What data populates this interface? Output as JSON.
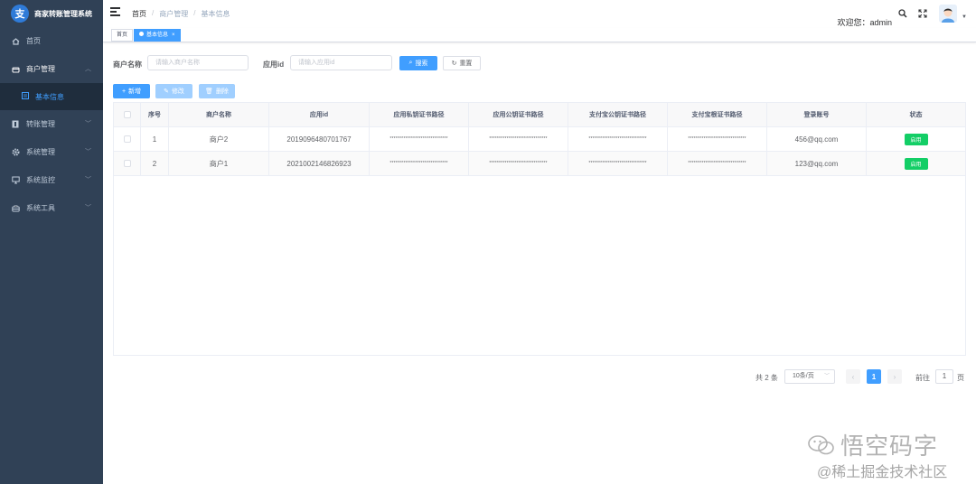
{
  "sidebar": {
    "logo_char": "支",
    "title": "商家转账管理系统",
    "items": [
      {
        "label": "首页",
        "icon": "dashboard-icon"
      },
      {
        "label": "商户管理",
        "icon": "shop-icon",
        "open": true,
        "children": [
          {
            "label": "基本信息",
            "icon": "list-icon",
            "active": true
          }
        ]
      },
      {
        "label": "转账管理",
        "icon": "transfer-icon"
      },
      {
        "label": "系统管理",
        "icon": "gear-icon"
      },
      {
        "label": "系统监控",
        "icon": "monitor-icon"
      },
      {
        "label": "系统工具",
        "icon": "toolbox-icon"
      }
    ]
  },
  "navbar": {
    "breadcrumb": [
      "首页",
      "商户管理",
      "基本信息"
    ],
    "welcome": "欢迎您：admin"
  },
  "tags": [
    {
      "label": "首页",
      "active": false
    },
    {
      "label": "基本信息",
      "active": true
    }
  ],
  "search": {
    "merchant_label": "商户名称",
    "merchant_placeholder": "请输入商户名称",
    "appid_label": "应用id",
    "appid_placeholder": "请输入应用id",
    "search_btn": "搜索",
    "reset_btn": "重置"
  },
  "toolbar": {
    "add_btn": "新增",
    "edit_btn": "修改",
    "delete_btn": "删除"
  },
  "table": {
    "columns": [
      "序号",
      "商户名称",
      "应用id",
      "应用私钥证书路径",
      "应用公钥证书路径",
      "支付宝公钥证书路径",
      "支付宝根证书路径",
      "登录账号",
      "状态"
    ],
    "rows": [
      {
        "index": "1",
        "name": "商户2",
        "appid": "2019096480701767",
        "app_private": "******************************",
        "app_public": "******************************",
        "alipay_public": "******************************",
        "alipay_root": "******************************",
        "account": "456@qq.com",
        "status": "启用"
      },
      {
        "index": "2",
        "name": "商户1",
        "appid": "2021002146826923",
        "app_private": "******************************",
        "app_public": "******************************",
        "alipay_public": "******************************",
        "alipay_root": "******************************",
        "account": "123@qq.com",
        "status": "启用"
      }
    ]
  },
  "pagination": {
    "total": "共 2 条",
    "page_size": "10条/页",
    "prev": "‹",
    "current": "1",
    "next": "›",
    "goto": "前往",
    "goto_value": "1",
    "page_suffix": "页"
  },
  "watermark": {
    "main": "悟空码字",
    "sub": "@稀土掘金技术社区"
  },
  "colors": {
    "sidebar_bg": "#304156",
    "accent": "#409eff",
    "success": "#13ce66"
  }
}
